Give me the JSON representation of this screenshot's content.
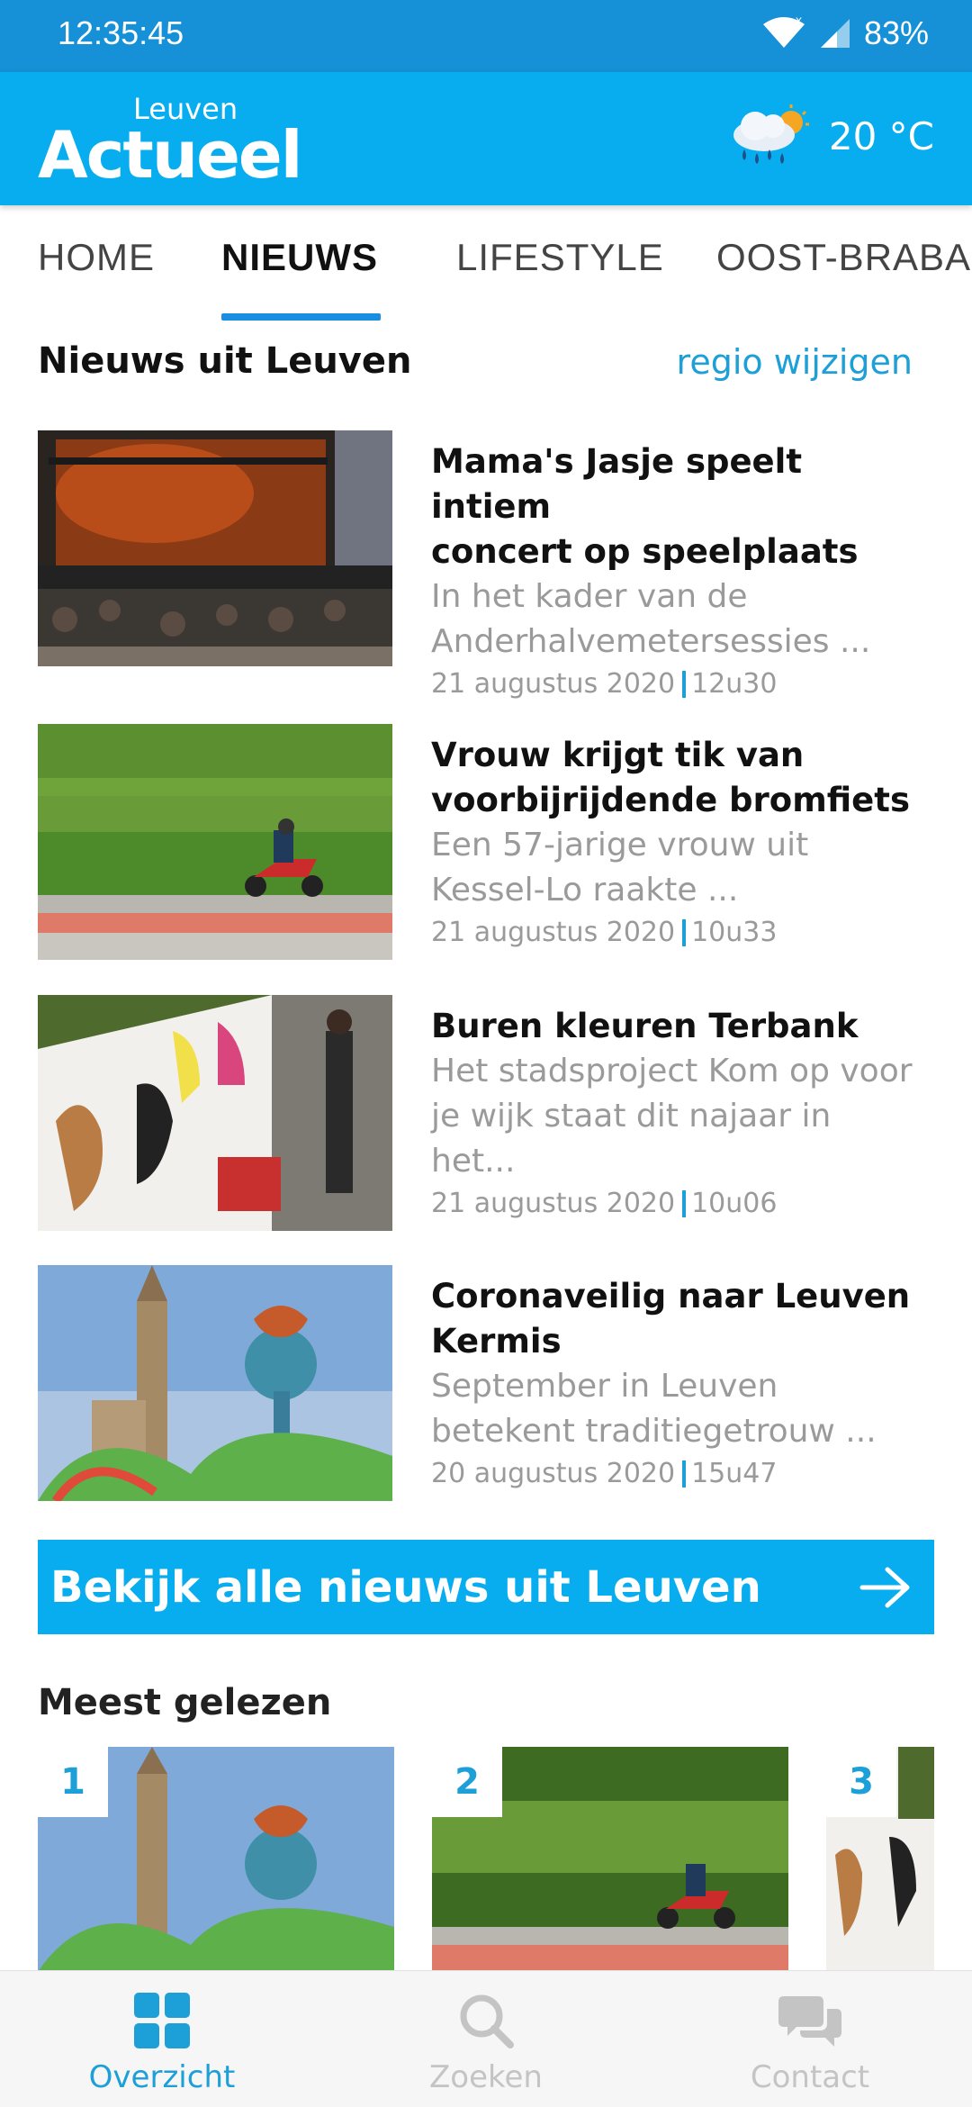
{
  "status_bar": {
    "time": "12:35:45",
    "battery": "83%"
  },
  "header": {
    "logo_small": "Leuven",
    "logo_big": "Actueel",
    "weather_icon": "rain-sun-cloud-icon",
    "temperature": "20 °C"
  },
  "tabs": [
    {
      "label": "HOME",
      "active": false
    },
    {
      "label": "NIEUWS",
      "active": true
    },
    {
      "label": "LIFESTYLE",
      "active": false
    },
    {
      "label": "OOST-BRABANT",
      "active": false
    }
  ],
  "section": {
    "title": "Nieuws uit Leuven",
    "region_link": "regio wijzigen"
  },
  "articles": [
    {
      "title_line1": "Mama's Jasje speelt intiem",
      "title_line2": "concert op speelplaats",
      "summary_line1": "In het kader van de",
      "summary_line2": "Anderhalvemetersessies ...",
      "date": "21 augustus 2020",
      "time": "12u30"
    },
    {
      "title_line1": "Vrouw krijgt tik van",
      "title_line2": "voorbijrijdende bromfiets",
      "summary_line1": "Een 57-jarige vrouw uit",
      "summary_line2": "Kessel-Lo raakte ...",
      "date": "21 augustus 2020",
      "time": "10u33"
    },
    {
      "title_line1": "Buren kleuren Terbank",
      "title_line2": "",
      "summary_line1": "Het stadsproject Kom op voor",
      "summary_line2": "je wijk staat dit najaar in het...",
      "date": "21 augustus 2020",
      "time": "10u06"
    },
    {
      "title_line1": "Coronaveilig naar Leuven",
      "title_line2": "Kermis",
      "summary_line1": "September in Leuven",
      "summary_line2": "betekent traditiegetrouw ...",
      "date": "20 augustus 2020",
      "time": "15u47"
    }
  ],
  "cta": {
    "label": "Bekijk alle nieuws uit Leuven",
    "icon": "arrow-right-icon"
  },
  "most_read": {
    "title": "Meest gelezen",
    "ranks": [
      "1",
      "2",
      "3"
    ]
  },
  "bottom_nav": [
    {
      "label": "Overzicht",
      "icon": "grid-icon",
      "active": true
    },
    {
      "label": "Zoeken",
      "icon": "search-icon",
      "active": false
    },
    {
      "label": "Contact",
      "icon": "chat-icon",
      "active": false
    }
  ],
  "colors": {
    "brand": "#07adef",
    "status_bar": "#1690d6",
    "link": "#1d9fd8"
  }
}
